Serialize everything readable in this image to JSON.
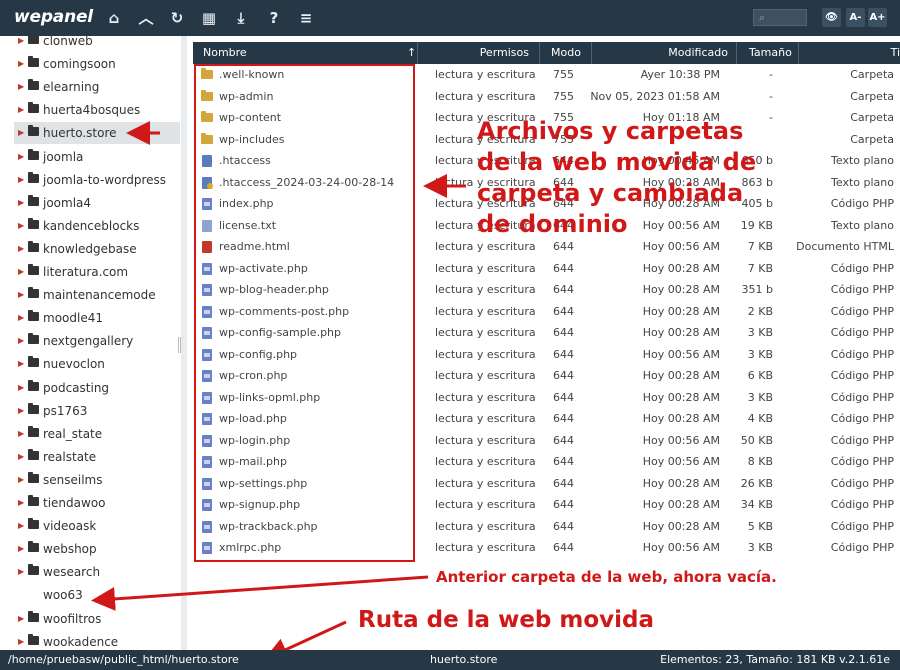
{
  "app": {
    "logo": "wepanel"
  },
  "toolbar": {
    "icons": [
      "home-icon",
      "up-icon",
      "refresh-icon",
      "grid-icon",
      "download-icon",
      "help-icon",
      "settings-icon"
    ],
    "search_placeholder": "⌕",
    "view_label": "👁",
    "font_down": "A-",
    "font_up": "A+"
  },
  "sidebar": {
    "items": [
      {
        "name": "clonweb"
      },
      {
        "name": "comingsoon"
      },
      {
        "name": "elearning"
      },
      {
        "name": "huerta4bosques"
      },
      {
        "name": "huerto.store",
        "active": true
      },
      {
        "name": "joomla"
      },
      {
        "name": "joomla-to-wordpress"
      },
      {
        "name": "joomla4"
      },
      {
        "name": "kandenceblocks"
      },
      {
        "name": "knowledgebase"
      },
      {
        "name": "literatura.com"
      },
      {
        "name": "maintenancemode"
      },
      {
        "name": "moodle41"
      },
      {
        "name": "nextgengallery"
      },
      {
        "name": "nuevoclon"
      },
      {
        "name": "podcasting"
      },
      {
        "name": "ps1763"
      },
      {
        "name": "real_state"
      },
      {
        "name": "realstate"
      },
      {
        "name": "senseilms"
      },
      {
        "name": "tiendawoo"
      },
      {
        "name": "videoask"
      },
      {
        "name": "webshop"
      },
      {
        "name": "wesearch"
      },
      {
        "name": "woo63",
        "nocaret": true
      },
      {
        "name": "woofiltros"
      },
      {
        "name": "wookadence"
      }
    ]
  },
  "table": {
    "headers": {
      "name": "Nombre",
      "sort": "↑",
      "perms": "Permisos",
      "mode": "Modo",
      "modified": "Modificado",
      "size": "Tamaño",
      "type": "Ti"
    },
    "rows": [
      {
        "icon": "folder",
        "name": ".well-known",
        "perms": "lectura y escritura",
        "mode": "755",
        "modified": "Ayer 10:38 PM",
        "size": "-",
        "type": "Carpeta"
      },
      {
        "icon": "folder",
        "name": "wp-admin",
        "perms": "lectura y escritura",
        "mode": "755",
        "modified": "Nov 05, 2023 01:58 AM",
        "size": "-",
        "type": "Carpeta"
      },
      {
        "icon": "folder",
        "name": "wp-content",
        "perms": "lectura y escritura",
        "mode": "755",
        "modified": "Hoy 01:18 AM",
        "size": "-",
        "type": "Carpeta"
      },
      {
        "icon": "folder",
        "name": "wp-includes",
        "perms": "lectura y escritura",
        "mode": "755",
        "modified": "",
        "size": "",
        "type": "Carpeta"
      },
      {
        "icon": "doc",
        "name": ".htaccess",
        "perms": "lectura y escritura",
        "mode": "644",
        "modified": "Hoy 00:45 AM",
        "size": "650 b",
        "type": "Texto plano"
      },
      {
        "icon": "doc bak",
        "name": ".htaccess_2024-03-24-00-28-14",
        "perms": "lectura y escritura",
        "mode": "644",
        "modified": "Hoy 00:28 AM",
        "size": "863 b",
        "type": "Texto plano"
      },
      {
        "icon": "php",
        "name": "index.php",
        "perms": "lectura y escritura",
        "mode": "644",
        "modified": "Hoy 00:28 AM",
        "size": "405 b",
        "type": "Código PHP"
      },
      {
        "icon": "txt",
        "name": "license.txt",
        "perms": "lectura y escritura",
        "mode": "644",
        "modified": "Hoy 00:56 AM",
        "size": "19 KB",
        "type": "Texto plano"
      },
      {
        "icon": "html",
        "name": "readme.html",
        "perms": "lectura y escritura",
        "mode": "644",
        "modified": "Hoy 00:56 AM",
        "size": "7 KB",
        "type": "Documento HTML"
      },
      {
        "icon": "php",
        "name": "wp-activate.php",
        "perms": "lectura y escritura",
        "mode": "644",
        "modified": "Hoy 00:28 AM",
        "size": "7 KB",
        "type": "Código PHP"
      },
      {
        "icon": "php",
        "name": "wp-blog-header.php",
        "perms": "lectura y escritura",
        "mode": "644",
        "modified": "Hoy 00:28 AM",
        "size": "351 b",
        "type": "Código PHP"
      },
      {
        "icon": "php",
        "name": "wp-comments-post.php",
        "perms": "lectura y escritura",
        "mode": "644",
        "modified": "Hoy 00:28 AM",
        "size": "2 KB",
        "type": "Código PHP"
      },
      {
        "icon": "php",
        "name": "wp-config-sample.php",
        "perms": "lectura y escritura",
        "mode": "644",
        "modified": "Hoy 00:28 AM",
        "size": "3 KB",
        "type": "Código PHP"
      },
      {
        "icon": "php",
        "name": "wp-config.php",
        "perms": "lectura y escritura",
        "mode": "644",
        "modified": "Hoy 00:56 AM",
        "size": "3 KB",
        "type": "Código PHP"
      },
      {
        "icon": "php",
        "name": "wp-cron.php",
        "perms": "lectura y escritura",
        "mode": "644",
        "modified": "Hoy 00:28 AM",
        "size": "6 KB",
        "type": "Código PHP"
      },
      {
        "icon": "php",
        "name": "wp-links-opml.php",
        "perms": "lectura y escritura",
        "mode": "644",
        "modified": "Hoy 00:28 AM",
        "size": "3 KB",
        "type": "Código PHP"
      },
      {
        "icon": "php",
        "name": "wp-load.php",
        "perms": "lectura y escritura",
        "mode": "644",
        "modified": "Hoy 00:28 AM",
        "size": "4 KB",
        "type": "Código PHP"
      },
      {
        "icon": "php",
        "name": "wp-login.php",
        "perms": "lectura y escritura",
        "mode": "644",
        "modified": "Hoy 00:56 AM",
        "size": "50 KB",
        "type": "Código PHP"
      },
      {
        "icon": "php",
        "name": "wp-mail.php",
        "perms": "lectura y escritura",
        "mode": "644",
        "modified": "Hoy 00:56 AM",
        "size": "8 KB",
        "type": "Código PHP"
      },
      {
        "icon": "php",
        "name": "wp-settings.php",
        "perms": "lectura y escritura",
        "mode": "644",
        "modified": "Hoy 00:28 AM",
        "size": "26 KB",
        "type": "Código PHP"
      },
      {
        "icon": "php",
        "name": "wp-signup.php",
        "perms": "lectura y escritura",
        "mode": "644",
        "modified": "Hoy 00:28 AM",
        "size": "34 KB",
        "type": "Código PHP"
      },
      {
        "icon": "php",
        "name": "wp-trackback.php",
        "perms": "lectura y escritura",
        "mode": "644",
        "modified": "Hoy 00:28 AM",
        "size": "5 KB",
        "type": "Código PHP"
      },
      {
        "icon": "php",
        "name": "xmlrpc.php",
        "perms": "lectura y escritura",
        "mode": "644",
        "modified": "Hoy 00:56 AM",
        "size": "3 KB",
        "type": "Código PHP"
      }
    ]
  },
  "status": {
    "path": "/home/pruebasw/public_html/huerto.store",
    "current": "huerto.store",
    "info": "Elementos: 23, Tamaño: 181 KB v.2.1.61e"
  },
  "annotations": {
    "big": [
      "Archivos y carpetas",
      "de la web movida de",
      "carpeta y cambiada",
      "de dominio"
    ],
    "previous": "Anterior carpeta de la web, ahora vacía.",
    "route": "Ruta de la web movida"
  },
  "colors": {
    "bar": "#263846",
    "accent_red": "#d01818",
    "folder": "#d4a53a"
  }
}
